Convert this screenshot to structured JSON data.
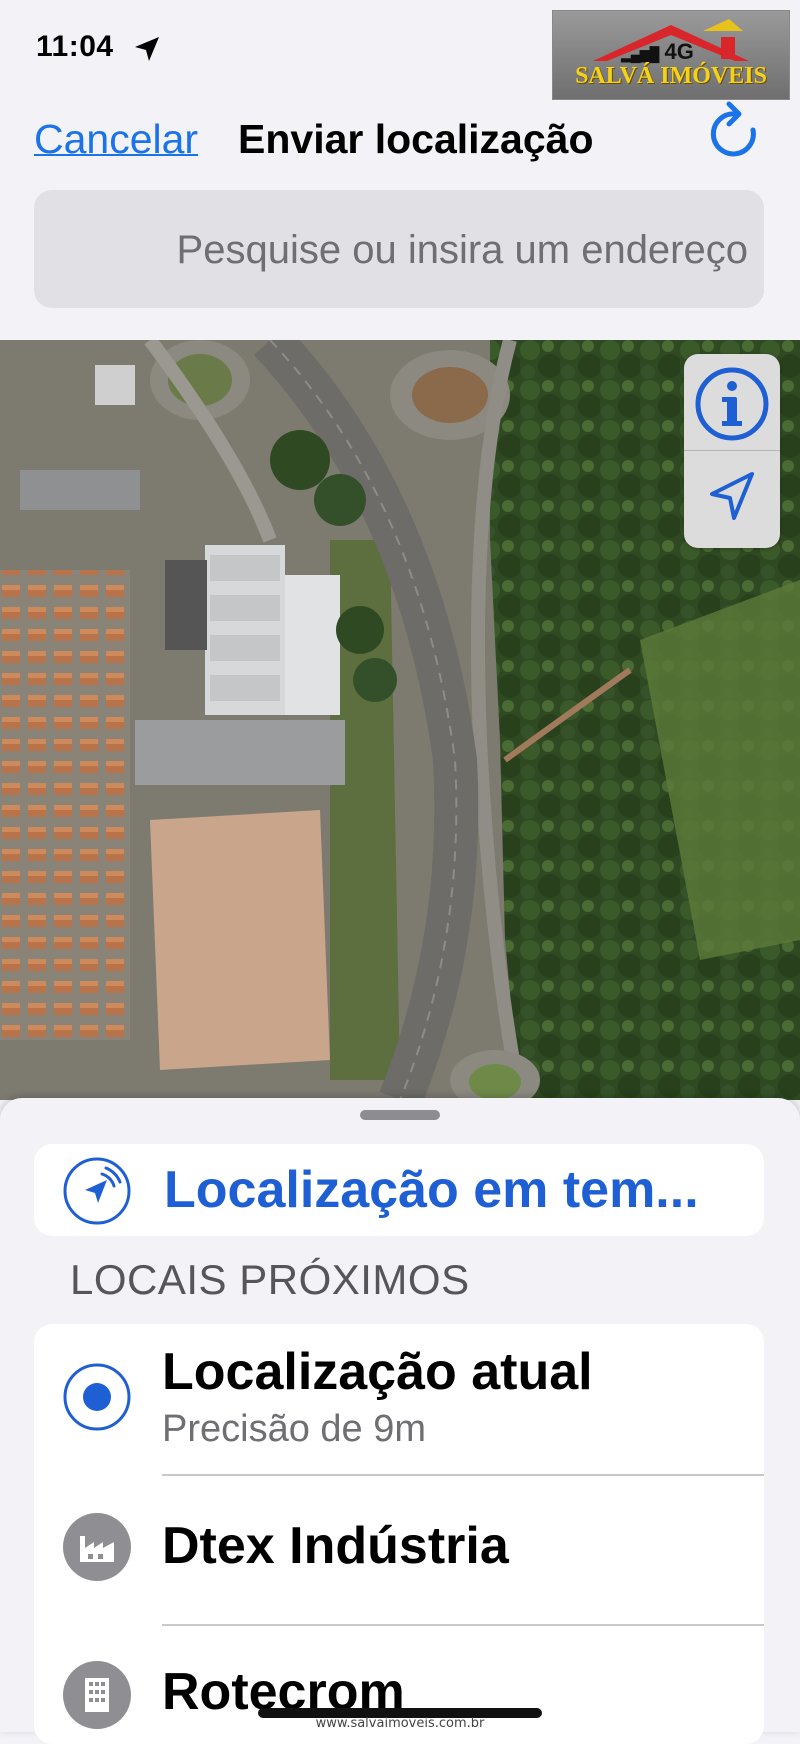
{
  "status_bar": {
    "time": "11:04",
    "network": "4G"
  },
  "watermark": {
    "brand": "SALVÁ IMÓVEIS",
    "url": "www.salvaimoveis.com.br"
  },
  "nav": {
    "cancel_label": "Cancelar",
    "title": "Enviar localização",
    "refresh_icon": "refresh-icon"
  },
  "search": {
    "placeholder": "Pesquise ou insira um endereço"
  },
  "map": {
    "type": "satellite",
    "info_icon": "info-icon",
    "locate_icon": "location-arrow-icon"
  },
  "sheet": {
    "live_location_label": "Localização em tem...",
    "section_header": "LOCAIS PRÓXIMOS",
    "places": [
      {
        "name": "Localização atual",
        "subtitle": "Precisão de 9m",
        "icon": "current-location-icon"
      },
      {
        "name": "Dtex Indústria",
        "subtitle": "",
        "icon": "factory-icon"
      },
      {
        "name": "Rotecrom",
        "subtitle": "",
        "icon": "building-icon"
      }
    ]
  },
  "colors": {
    "accent": "#1a73e8",
    "live_text": "#1e5fd4",
    "sheet_bg": "#f2f2f7",
    "secondary_text": "#6e6e73"
  }
}
